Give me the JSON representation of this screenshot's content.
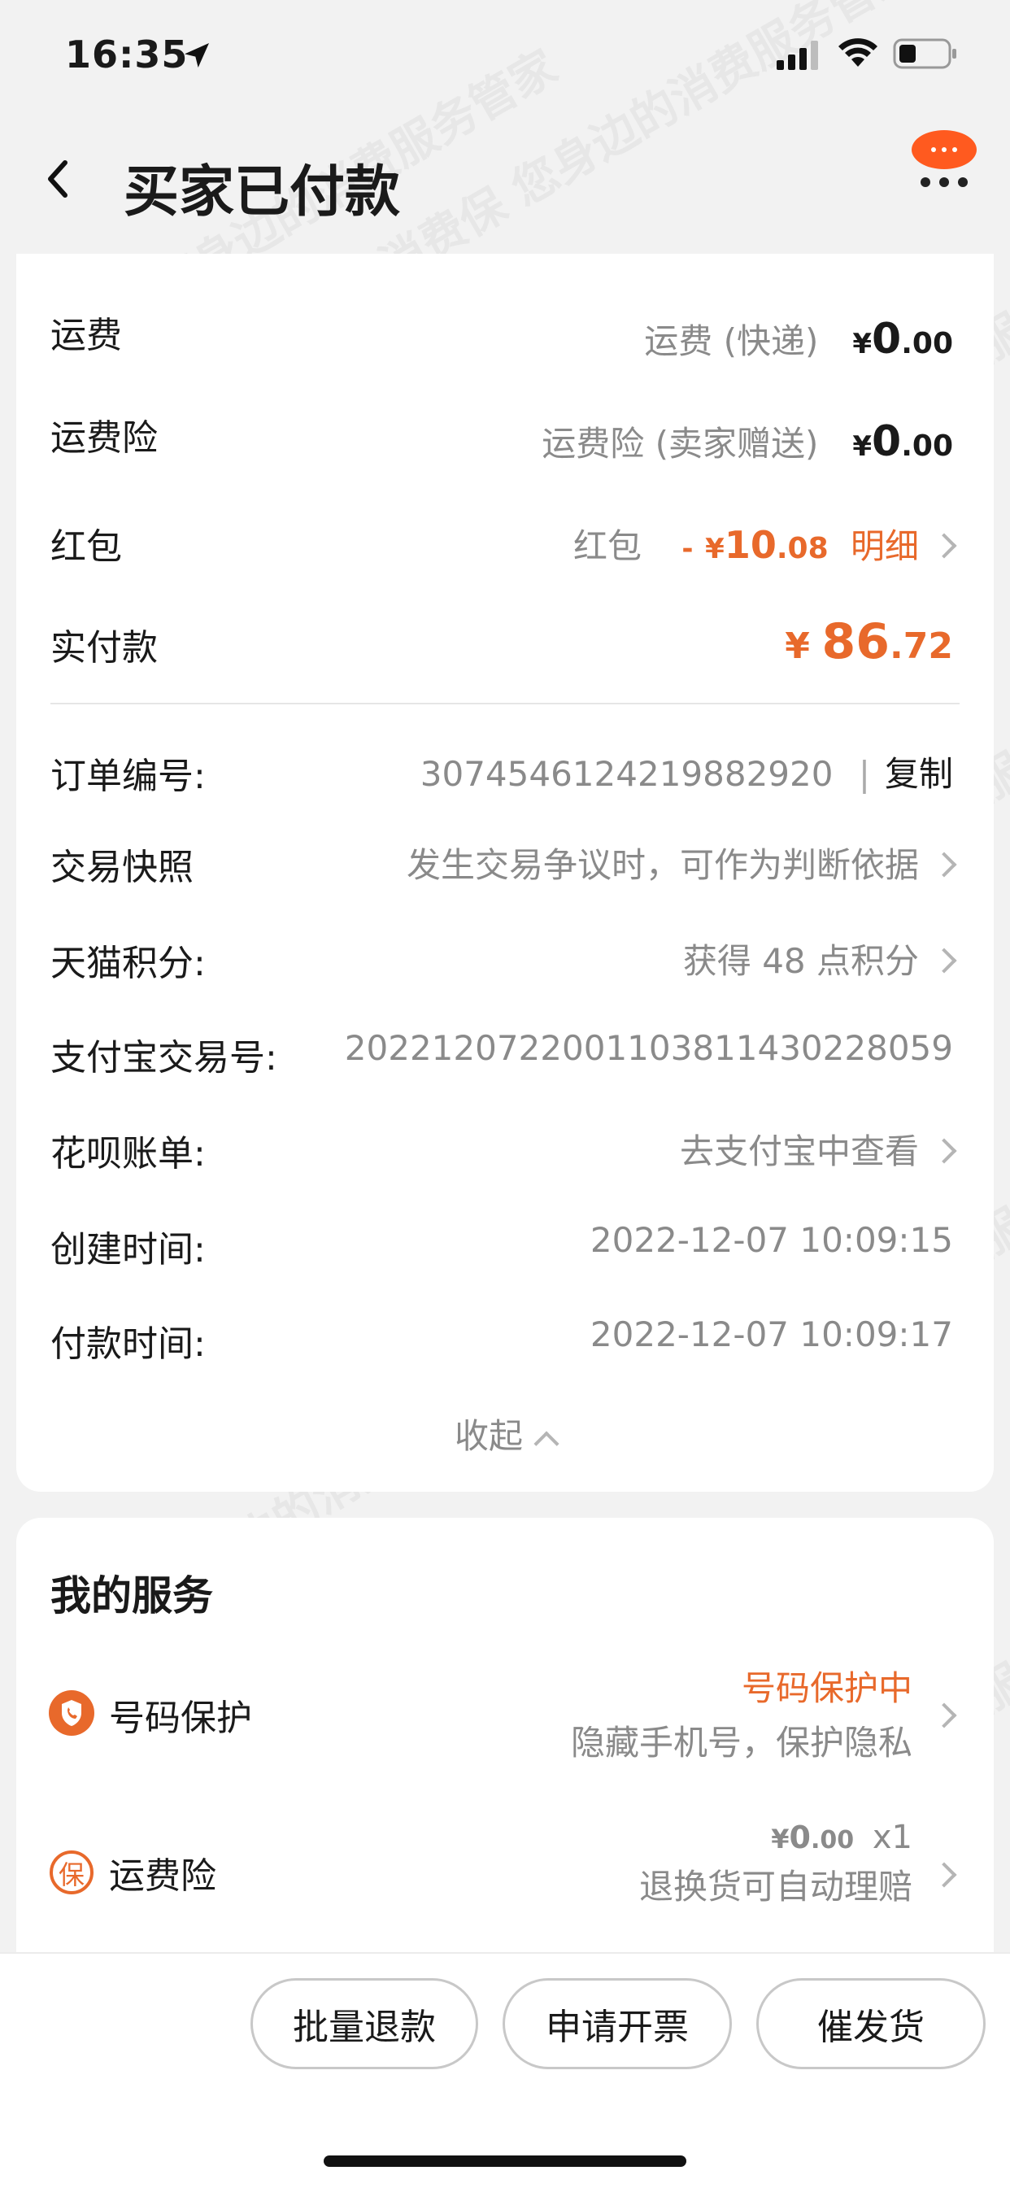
{
  "status_bar": {
    "time": "16:35"
  },
  "nav": {
    "title": "买家已付款",
    "menu_dots": "···"
  },
  "fee_rows": [
    {
      "label": "运费",
      "desc": "运费 (快递)",
      "currency": "¥",
      "int": "0",
      "dec": ".00"
    },
    {
      "label": "运费险",
      "desc": "运费险 (卖家赠送)",
      "currency": "¥",
      "int": "0",
      "dec": ".00"
    }
  ],
  "redpacket": {
    "label": "红包",
    "desc": "红包",
    "sign": "-",
    "currency": "¥",
    "int": "10",
    "dec": ".08",
    "detail": "明细"
  },
  "paid": {
    "label": "实付款",
    "currency": "¥",
    "int": "86",
    "dec": ".72"
  },
  "order_info": {
    "order_no_label": "订单编号:",
    "order_no": "3074546124219882920",
    "copy": "复制",
    "sep": "|",
    "snapshot_label": "交易快照",
    "snapshot_value": "发生交易争议时，可作为判断依据",
    "points_label": "天猫积分:",
    "points_value": "获得 48 点积分",
    "alipay_label": "支付宝交易号:",
    "alipay_value": "2022120722001103811430228059",
    "huabei_label": "花呗账单:",
    "huabei_value": "去支付宝中查看",
    "created_label": "创建时间:",
    "created_value": "2022-12-07 10:09:15",
    "paid_label": "付款时间:",
    "paid_value": "2022-12-07 10:09:17",
    "collapse": "收起"
  },
  "services": {
    "title": "我的服务",
    "phone": {
      "label": "号码保护",
      "status": "号码保护中",
      "desc": "隐藏手机号，保护隐私",
      "icon": "phone-shield-icon"
    },
    "insurance": {
      "label": "运费险",
      "icon_char": "保",
      "currency": "¥",
      "int": "0",
      "dec": ".00",
      "qty": "x1",
      "desc": "退换货可自动理赔"
    }
  },
  "actions": {
    "refund": "批量退款",
    "invoice": "申请开票",
    "urge": "催发货"
  },
  "watermark": "消费保 您身边的消费服务管家",
  "colors": {
    "accent": "#ff5000",
    "orange": "#e8692b"
  }
}
